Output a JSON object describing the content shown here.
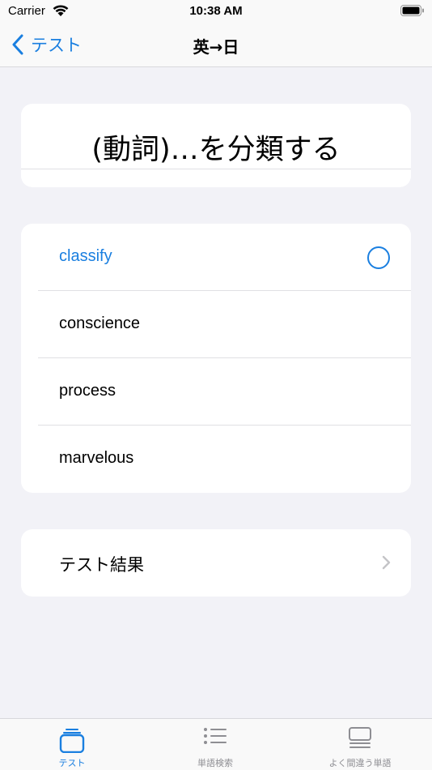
{
  "status_bar": {
    "carrier": "Carrier",
    "time": "10:38 AM"
  },
  "nav": {
    "back_label": "テスト",
    "title": "英→日"
  },
  "question": {
    "text": "(動詞)…を分類する"
  },
  "choices": [
    {
      "label": "classify",
      "selected": true
    },
    {
      "label": "conscience",
      "selected": false
    },
    {
      "label": "process",
      "selected": false
    },
    {
      "label": "marvelous",
      "selected": false
    }
  ],
  "result": {
    "label": "テスト結果"
  },
  "tabs": [
    {
      "label": "テスト",
      "icon": "cards-icon",
      "active": true
    },
    {
      "label": "単語検索",
      "icon": "list-icon",
      "active": false
    },
    {
      "label": "よく間違う単語",
      "icon": "stack-icon",
      "active": false
    }
  ],
  "colors": {
    "accent": "#1A7FE0",
    "background": "#F2F2F7",
    "card": "#FFFFFF",
    "inactive": "#8E8E93"
  }
}
